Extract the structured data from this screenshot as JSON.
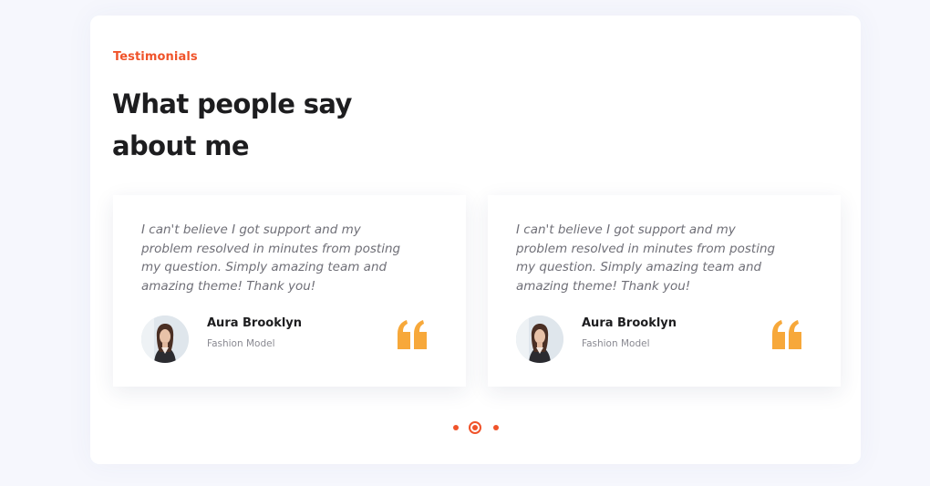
{
  "section": {
    "eyebrow": "Testimonials",
    "heading": "What people say about me"
  },
  "testimonials": [
    {
      "quote": "I can't believe I got support and my problem resolved in minutes from posting my question. Simply amazing team and amazing theme! Thank you!",
      "name": "Aura Brooklyn",
      "role": "Fashion Model",
      "avatar_icon": "person-photo",
      "quote_icon": "quote-mark-icon"
    },
    {
      "quote": "I can't believe I got support and my problem resolved in minutes from posting my question. Simply amazing team and amazing theme! Thank you!",
      "name": "Aura Brooklyn",
      "role": "Fashion Model",
      "avatar_icon": "person-photo",
      "quote_icon": "quote-mark-icon"
    }
  ],
  "pagination": {
    "count": 3,
    "active_index": 1
  },
  "colors": {
    "accent": "#f0532a",
    "quote_icon": "#f7a83a",
    "heading": "#1d1d1f",
    "body_text": "#6f6f77",
    "background": "#f6f7fd"
  }
}
